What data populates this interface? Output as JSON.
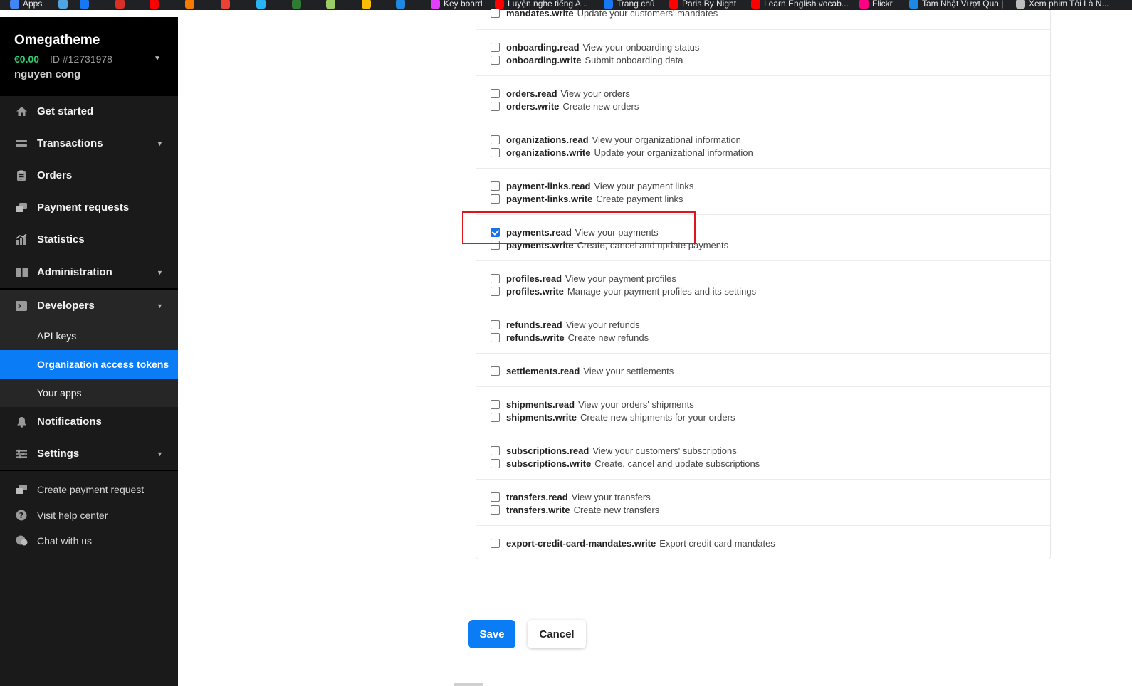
{
  "bookmarks": [
    {
      "label": "Apps",
      "icon": "apps-grid-icon",
      "color": "#4285f4"
    },
    {
      "label": "",
      "icon": "vector-icon",
      "color": "#4fa3e0"
    },
    {
      "label": "",
      "icon": "facebook-icon",
      "color": "#1877f2"
    },
    {
      "label": "",
      "icon": "bookmark-icon",
      "color": "#d93025"
    },
    {
      "label": "",
      "icon": "youtube-icon",
      "color": "#ff0000"
    },
    {
      "label": "",
      "icon": "fin-icon",
      "color": "#f57c00"
    },
    {
      "label": "",
      "icon": "gmail-icon",
      "color": "#ea4335"
    },
    {
      "label": "",
      "icon": "cloud-icon",
      "color": "#29b6f6"
    },
    {
      "label": "",
      "icon": "d-icon",
      "color": "#2e7d32"
    },
    {
      "label": "",
      "icon": "clock-icon",
      "color": "#9ccc65"
    },
    {
      "label": "",
      "icon": "docs-icon",
      "color": "#fbbc04"
    },
    {
      "label": "",
      "icon": "check-icon",
      "color": "#1e88e5"
    },
    {
      "label": "Key board",
      "icon": "keyboard-icon",
      "color": "#e040fb"
    },
    {
      "label": "Luyện nghe tiếng A...",
      "icon": "youtube-icon",
      "color": "#ff0000"
    },
    {
      "label": "Trang chủ",
      "icon": "facebook-icon",
      "color": "#1877f2"
    },
    {
      "label": "Paris By Night",
      "icon": "youtube-icon",
      "color": "#ff0000"
    },
    {
      "label": "Learn English vocab...",
      "icon": "youtube-icon",
      "color": "#ff0000"
    },
    {
      "label": "Flickr",
      "icon": "flickr-icon",
      "color": "#ff0084"
    },
    {
      "label": "Tam Nhật Vượt Qua |",
      "icon": "check-icon",
      "color": "#1e88e5"
    },
    {
      "label": "Xem phim Tôi Là N...",
      "icon": "globe-icon",
      "color": "#bdbdbd"
    }
  ],
  "account": {
    "org_name": "Omegatheme",
    "balance": "€0.00",
    "org_id": "ID #12731978",
    "user_name": "nguyen cong"
  },
  "nav": {
    "get_started": "Get started",
    "transactions": "Transactions",
    "orders": "Orders",
    "payment_requests": "Payment requests",
    "statistics": "Statistics",
    "administration": "Administration",
    "developers": "Developers",
    "api_keys": "API keys",
    "org_access_tokens": "Organization access tokens",
    "your_apps": "Your apps",
    "notifications": "Notifications",
    "settings": "Settings",
    "create_payment_request": "Create payment request",
    "visit_help_center": "Visit help center",
    "chat_with_us": "Chat with us"
  },
  "partial_top": {
    "name": "mandates.write",
    "desc": "Update your customers' mandates"
  },
  "permission_groups": [
    [
      {
        "name": "onboarding.read",
        "desc": "View your onboarding status",
        "checked": false
      },
      {
        "name": "onboarding.write",
        "desc": "Submit onboarding data",
        "checked": false
      }
    ],
    [
      {
        "name": "orders.read",
        "desc": "View your orders",
        "checked": false
      },
      {
        "name": "orders.write",
        "desc": "Create new orders",
        "checked": false
      }
    ],
    [
      {
        "name": "organizations.read",
        "desc": "View your organizational information",
        "checked": false
      },
      {
        "name": "organizations.write",
        "desc": "Update your organizational information",
        "checked": false
      }
    ],
    [
      {
        "name": "payment-links.read",
        "desc": "View your payment links",
        "checked": false
      },
      {
        "name": "payment-links.write",
        "desc": "Create payment links",
        "checked": false
      }
    ],
    [
      {
        "name": "payments.read",
        "desc": "View your payments",
        "checked": true
      },
      {
        "name": "payments.write",
        "desc": "Create, cancel and update payments",
        "checked": false
      }
    ],
    [
      {
        "name": "profiles.read",
        "desc": "View your payment profiles",
        "checked": false
      },
      {
        "name": "profiles.write",
        "desc": "Manage your payment profiles and its settings",
        "checked": false
      }
    ],
    [
      {
        "name": "refunds.read",
        "desc": "View your refunds",
        "checked": false
      },
      {
        "name": "refunds.write",
        "desc": "Create new refunds",
        "checked": false
      }
    ],
    [
      {
        "name": "settlements.read",
        "desc": "View your settlements",
        "checked": false
      }
    ],
    [
      {
        "name": "shipments.read",
        "desc": "View your orders' shipments",
        "checked": false
      },
      {
        "name": "shipments.write",
        "desc": "Create new shipments for your orders",
        "checked": false
      }
    ],
    [
      {
        "name": "subscriptions.read",
        "desc": "View your customers' subscriptions",
        "checked": false
      },
      {
        "name": "subscriptions.write",
        "desc": "Create, cancel and update subscriptions",
        "checked": false
      }
    ],
    [
      {
        "name": "transfers.read",
        "desc": "View your transfers",
        "checked": false
      },
      {
        "name": "transfers.write",
        "desc": "Create new transfers",
        "checked": false
      }
    ],
    [
      {
        "name": "export-credit-card-mandates.write",
        "desc": "Export credit card mandates",
        "checked": false
      }
    ]
  ],
  "actions": {
    "save": "Save",
    "cancel": "Cancel"
  },
  "colors": {
    "accent": "#0a7cf5",
    "sidebar_bg": "#1a1a1a",
    "balance_green": "#2ecc71",
    "highlight_red": "#e0141e"
  }
}
